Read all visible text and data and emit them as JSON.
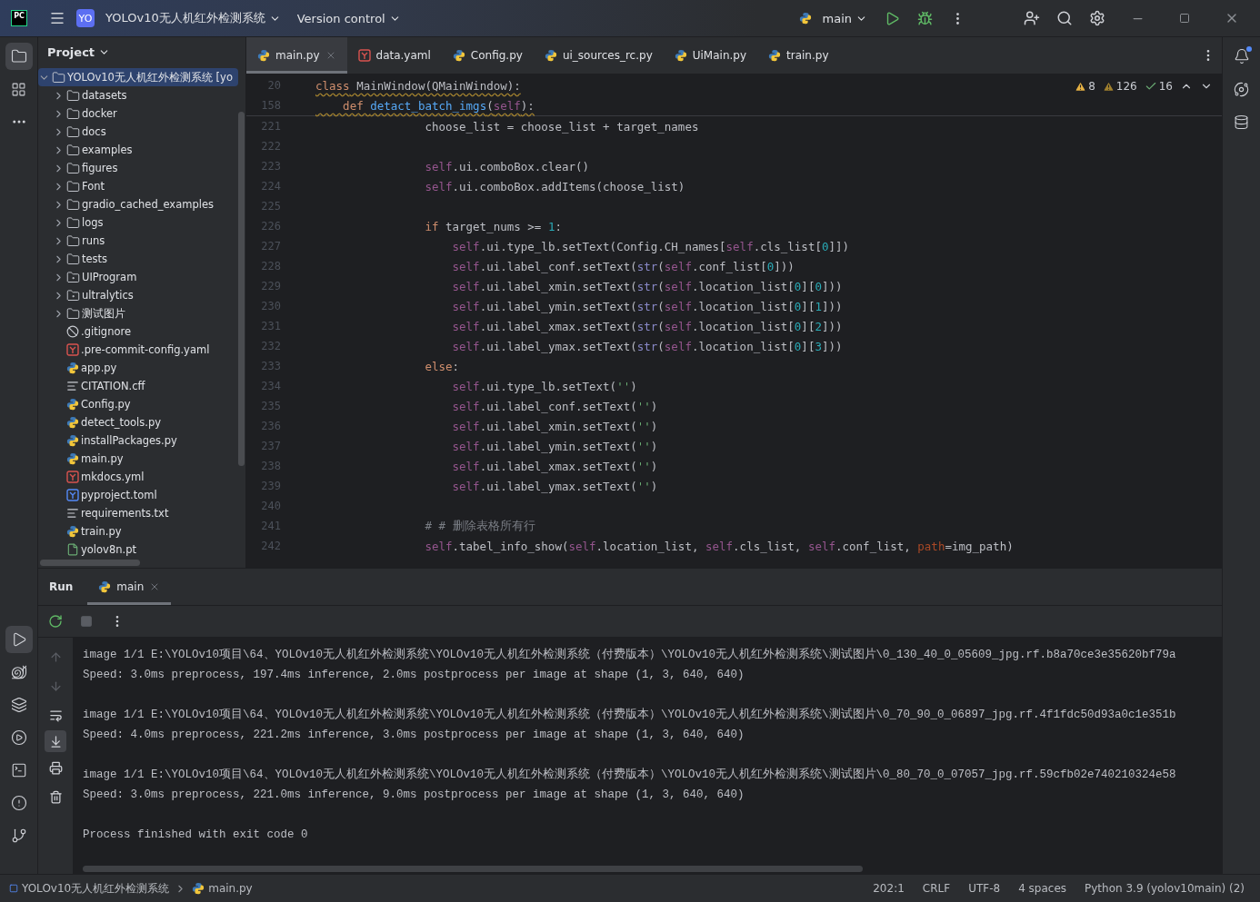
{
  "title_bar": {
    "app_logo": "PC",
    "project_badge": "YO",
    "project_name": "YOLOv10无人机红外检测系统",
    "vcs": "Version control",
    "run_config": "main"
  },
  "project_panel": {
    "title": "Project",
    "tree": [
      {
        "label": "YOLOv10无人机红外检测系统 [yo",
        "kind": "folder",
        "expanded": true,
        "selected": true,
        "children": [
          {
            "label": "datasets",
            "kind": "folder",
            "expanded": false,
            "selected": false
          },
          {
            "label": "docker",
            "kind": "folder",
            "expanded": false,
            "selected": false
          },
          {
            "label": "docs",
            "kind": "folder",
            "expanded": false,
            "selected": false
          },
          {
            "label": "examples",
            "kind": "folder",
            "expanded": false,
            "selected": false
          },
          {
            "label": "figures",
            "kind": "folder",
            "expanded": false,
            "selected": false
          },
          {
            "label": "Font",
            "kind": "folder",
            "expanded": false,
            "selected": false
          },
          {
            "label": "gradio_cached_examples",
            "kind": "folder",
            "expanded": false,
            "selected": false
          },
          {
            "label": "logs",
            "kind": "folder",
            "expanded": false,
            "selected": false
          },
          {
            "label": "runs",
            "kind": "folder",
            "expanded": false,
            "selected": false
          },
          {
            "label": "tests",
            "kind": "folder",
            "expanded": false,
            "selected": false
          },
          {
            "label": "UIProgram",
            "kind": "package",
            "expanded": false,
            "selected": false
          },
          {
            "label": "ultralytics",
            "kind": "package",
            "expanded": false,
            "selected": false
          },
          {
            "label": "测试图片",
            "kind": "folder",
            "expanded": false,
            "selected": false
          },
          {
            "label": ".gitignore",
            "kind": "ignore",
            "selected": false
          },
          {
            "label": ".pre-commit-config.yaml",
            "kind": "yaml",
            "selected": false
          },
          {
            "label": "app.py",
            "kind": "python",
            "selected": false
          },
          {
            "label": "CITATION.cff",
            "kind": "text",
            "selected": false
          },
          {
            "label": "Config.py",
            "kind": "python",
            "selected": false
          },
          {
            "label": "detect_tools.py",
            "kind": "python",
            "selected": false
          },
          {
            "label": "installPackages.py",
            "kind": "python",
            "selected": false
          },
          {
            "label": "main.py",
            "kind": "python",
            "selected": false
          },
          {
            "label": "mkdocs.yml",
            "kind": "yaml",
            "selected": false
          },
          {
            "label": "pyproject.toml",
            "kind": "toml",
            "selected": false
          },
          {
            "label": "requirements.txt",
            "kind": "text",
            "selected": false
          },
          {
            "label": "train.py",
            "kind": "python",
            "selected": false
          },
          {
            "label": "yolov8n.pt",
            "kind": "binary",
            "selected": false
          }
        ]
      }
    ]
  },
  "editor_tabs": [
    {
      "label": "main.py",
      "kind": "python",
      "selected": true
    },
    {
      "label": "data.yaml",
      "kind": "yaml",
      "selected": false
    },
    {
      "label": "Config.py",
      "kind": "python",
      "selected": false
    },
    {
      "label": "ui_sources_rc.py",
      "kind": "python",
      "selected": false
    },
    {
      "label": "UiMain.py",
      "kind": "python",
      "selected": false
    },
    {
      "label": "train.py",
      "kind": "python",
      "selected": false
    }
  ],
  "inspections": [
    {
      "kind": "warning",
      "count": "8"
    },
    {
      "kind": "weak",
      "count": "126"
    },
    {
      "kind": "typo",
      "count": "16"
    }
  ],
  "sticky_lines": [
    {
      "number": "20",
      "tokens": [
        {
          "kind": "kw",
          "text": "class"
        },
        {
          "kind": "p",
          "text": " MainWindow(QMainWindow):"
        }
      ]
    },
    {
      "number": "158",
      "tokens": [
        {
          "kind": "kw",
          "text": "    def "
        },
        {
          "kind": "fn",
          "text": "detact_batch_imgs"
        },
        {
          "kind": "p",
          "text": "("
        },
        {
          "kind": "self",
          "text": "self"
        },
        {
          "kind": "p",
          "text": "):"
        }
      ]
    }
  ],
  "code_lines": [
    {
      "number": "221",
      "tokens": [
        {
          "kind": "p",
          "text": "                choose_list = choose_list + target_names"
        }
      ]
    },
    {
      "number": "222"
    },
    {
      "number": "223",
      "tokens": [
        {
          "kind": "self",
          "text": "                self"
        },
        {
          "kind": "p",
          "text": ".ui.comboBox.clear()"
        }
      ]
    },
    {
      "number": "224",
      "tokens": [
        {
          "kind": "self",
          "text": "                self"
        },
        {
          "kind": "p",
          "text": ".ui.comboBox.addItems(choose_list)"
        }
      ]
    },
    {
      "number": "225"
    },
    {
      "number": "226",
      "tokens": [
        {
          "kind": "kw",
          "text": "                if"
        },
        {
          "kind": "p",
          "text": " target_nums >= "
        },
        {
          "kind": "num",
          "text": "1"
        },
        {
          "kind": "p",
          "text": ":"
        }
      ]
    },
    {
      "number": "227",
      "tokens": [
        {
          "kind": "self",
          "text": "                    self"
        },
        {
          "kind": "p",
          "text": ".ui.type_lb.setText(Config.CH_names["
        },
        {
          "kind": "self",
          "text": "self"
        },
        {
          "kind": "p",
          "text": ".cls_list["
        },
        {
          "kind": "num",
          "text": "0"
        },
        {
          "kind": "p",
          "text": "]])"
        }
      ]
    },
    {
      "number": "228",
      "tokens": [
        {
          "kind": "self",
          "text": "                    self"
        },
        {
          "kind": "p",
          "text": ".ui.label_conf.setText("
        },
        {
          "kind": "bi",
          "text": "str"
        },
        {
          "kind": "p",
          "text": "("
        },
        {
          "kind": "self",
          "text": "self"
        },
        {
          "kind": "p",
          "text": ".conf_list["
        },
        {
          "kind": "num",
          "text": "0"
        },
        {
          "kind": "p",
          "text": "]))"
        }
      ]
    },
    {
      "number": "229",
      "tokens": [
        {
          "kind": "self",
          "text": "                    self"
        },
        {
          "kind": "p",
          "text": ".ui.label_xmin.setText("
        },
        {
          "kind": "bi",
          "text": "str"
        },
        {
          "kind": "p",
          "text": "("
        },
        {
          "kind": "self",
          "text": "self"
        },
        {
          "kind": "p",
          "text": ".location_list["
        },
        {
          "kind": "num",
          "text": "0"
        },
        {
          "kind": "p",
          "text": "]["
        },
        {
          "kind": "num",
          "text": "0"
        },
        {
          "kind": "p",
          "text": "]))"
        }
      ]
    },
    {
      "number": "230",
      "tokens": [
        {
          "kind": "self",
          "text": "                    self"
        },
        {
          "kind": "p",
          "text": ".ui.label_ymin.setText("
        },
        {
          "kind": "bi",
          "text": "str"
        },
        {
          "kind": "p",
          "text": "("
        },
        {
          "kind": "self",
          "text": "self"
        },
        {
          "kind": "p",
          "text": ".location_list["
        },
        {
          "kind": "num",
          "text": "0"
        },
        {
          "kind": "p",
          "text": "]["
        },
        {
          "kind": "num",
          "text": "1"
        },
        {
          "kind": "p",
          "text": "]))"
        }
      ]
    },
    {
      "number": "231",
      "tokens": [
        {
          "kind": "self",
          "text": "                    self"
        },
        {
          "kind": "p",
          "text": ".ui.label_xmax.setText("
        },
        {
          "kind": "bi",
          "text": "str"
        },
        {
          "kind": "p",
          "text": "("
        },
        {
          "kind": "self",
          "text": "self"
        },
        {
          "kind": "p",
          "text": ".location_list["
        },
        {
          "kind": "num",
          "text": "0"
        },
        {
          "kind": "p",
          "text": "]["
        },
        {
          "kind": "num",
          "text": "2"
        },
        {
          "kind": "p",
          "text": "]))"
        }
      ]
    },
    {
      "number": "232",
      "tokens": [
        {
          "kind": "self",
          "text": "                    self"
        },
        {
          "kind": "p",
          "text": ".ui.label_ymax.setText("
        },
        {
          "kind": "bi",
          "text": "str"
        },
        {
          "kind": "p",
          "text": "("
        },
        {
          "kind": "self",
          "text": "self"
        },
        {
          "kind": "p",
          "text": ".location_list["
        },
        {
          "kind": "num",
          "text": "0"
        },
        {
          "kind": "p",
          "text": "]["
        },
        {
          "kind": "num",
          "text": "3"
        },
        {
          "kind": "p",
          "text": "]))"
        }
      ]
    },
    {
      "number": "233",
      "tokens": [
        {
          "kind": "kw",
          "text": "                else"
        },
        {
          "kind": "p",
          "text": ":"
        }
      ]
    },
    {
      "number": "234",
      "tokens": [
        {
          "kind": "self",
          "text": "                    self"
        },
        {
          "kind": "p",
          "text": ".ui.type_lb.setText("
        },
        {
          "kind": "str",
          "text": "''"
        },
        {
          "kind": "p",
          "text": ")"
        }
      ]
    },
    {
      "number": "235",
      "tokens": [
        {
          "kind": "self",
          "text": "                    self"
        },
        {
          "kind": "p",
          "text": ".ui.label_conf.setText("
        },
        {
          "kind": "str",
          "text": "''"
        },
        {
          "kind": "p",
          "text": ")"
        }
      ]
    },
    {
      "number": "236",
      "tokens": [
        {
          "kind": "self",
          "text": "                    self"
        },
        {
          "kind": "p",
          "text": ".ui.label_xmin.setText("
        },
        {
          "kind": "str",
          "text": "''"
        },
        {
          "kind": "p",
          "text": ")"
        }
      ]
    },
    {
      "number": "237",
      "tokens": [
        {
          "kind": "self",
          "text": "                    self"
        },
        {
          "kind": "p",
          "text": ".ui.label_ymin.setText("
        },
        {
          "kind": "str",
          "text": "''"
        },
        {
          "kind": "p",
          "text": ")"
        }
      ]
    },
    {
      "number": "238",
      "tokens": [
        {
          "kind": "self",
          "text": "                    self"
        },
        {
          "kind": "p",
          "text": ".ui.label_xmax.setText("
        },
        {
          "kind": "str",
          "text": "''"
        },
        {
          "kind": "p",
          "text": ")"
        }
      ]
    },
    {
      "number": "239",
      "tokens": [
        {
          "kind": "self",
          "text": "                    self"
        },
        {
          "kind": "p",
          "text": ".ui.label_ymax.setText("
        },
        {
          "kind": "str",
          "text": "''"
        },
        {
          "kind": "p",
          "text": ")"
        }
      ]
    },
    {
      "number": "240"
    },
    {
      "number": "241",
      "tokens": [
        {
          "kind": "cm",
          "text": "                # # 删除表格所有行"
        }
      ]
    },
    {
      "number": "242",
      "tokens": [
        {
          "kind": "self",
          "text": "                self"
        },
        {
          "kind": "p",
          "text": ".tabel_info_show("
        },
        {
          "kind": "self",
          "text": "self"
        },
        {
          "kind": "p",
          "text": ".location_list, "
        },
        {
          "kind": "self",
          "text": "self"
        },
        {
          "kind": "p",
          "text": ".cls_list, "
        },
        {
          "kind": "self",
          "text": "self"
        },
        {
          "kind": "p",
          "text": ".conf_list, "
        },
        {
          "kind": "param",
          "text": "path"
        },
        {
          "kind": "p",
          "text": "=img_path)"
        }
      ]
    }
  ],
  "run_panel": {
    "title": "Run",
    "tabs": [
      {
        "label": "main",
        "selected": true
      }
    ],
    "console": [
      [
        "image 1/1 E:\\YOLOv10项目\\64、YOLOv10无人机红外检测系统\\YOLOv10无人机红外检测系统（付费版本）\\YOLOv10无人机红外检测系统\\测试图片\\0_130_40_0_05609_jpg.rf.b8a70ce3e35620bf79a",
        "Speed: 3.0ms preprocess, 197.4ms inference, 2.0ms postprocess per image at shape (1, 3, 640, 640)"
      ],
      [
        "image 1/1 E:\\YOLOv10项目\\64、YOLOv10无人机红外检测系统\\YOLOv10无人机红外检测系统（付费版本）\\YOLOv10无人机红外检测系统\\测试图片\\0_70_90_0_06897_jpg.rf.4f1fdc50d93a0c1e351b",
        "Speed: 4.0ms preprocess, 221.2ms inference, 3.0ms postprocess per image at shape (1, 3, 640, 640)"
      ],
      [
        "image 1/1 E:\\YOLOv10项目\\64、YOLOv10无人机红外检测系统\\YOLOv10无人机红外检测系统（付费版本）\\YOLOv10无人机红外检测系统\\测试图片\\0_80_70_0_07057_jpg.rf.59cfb02e740210324e58",
        "Speed: 3.0ms preprocess, 221.0ms inference, 9.0ms postprocess per image at shape (1, 3, 640, 640)"
      ],
      [
        "Process finished with exit code 0"
      ]
    ]
  },
  "status_bar": {
    "breadcrumbs": [
      {
        "label": "YOLOv10无人机红外检测系统",
        "kind": "project"
      },
      {
        "label": "main.py",
        "kind": "python"
      }
    ],
    "items": [
      "202:1",
      "CRLF",
      "UTF-8",
      "4 spaces",
      "Python 3.9 (yolov10main) (2)"
    ]
  }
}
